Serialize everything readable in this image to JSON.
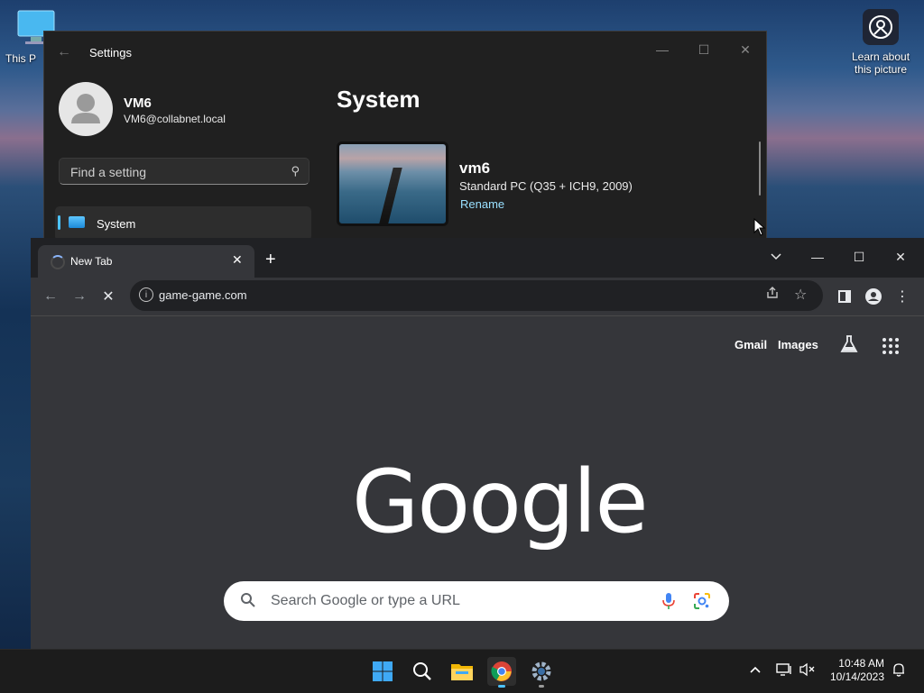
{
  "desktop": {
    "this_pc_label": "This P",
    "learn_label": "Learn about this picture"
  },
  "settings": {
    "title": "Settings",
    "user": {
      "name": "VM6",
      "email": "VM6@collabnet.local"
    },
    "search_placeholder": "Find a setting",
    "nav_items": [
      {
        "label": "System",
        "selected": true
      }
    ],
    "heading": "System",
    "device": {
      "name": "vm6",
      "model": "Standard PC (Q35 + ICH9, 2009)",
      "rename_label": "Rename"
    }
  },
  "browser": {
    "tab": {
      "title": "New Tab"
    },
    "address": "game-game.com",
    "links": {
      "gmail": "Gmail",
      "images": "Images"
    },
    "logo": "Google",
    "search_placeholder": "Search Google or type a URL"
  },
  "taskbar": {
    "time": "10:48 AM",
    "date": "10/14/2023",
    "pinned": [
      "start-icon",
      "search-icon",
      "file-explorer-icon",
      "chrome-icon",
      "settings-icon"
    ]
  },
  "colors": {
    "accent": "#4cc2ff",
    "link": "#99e0ff",
    "chrome_bg": "#35363a"
  }
}
